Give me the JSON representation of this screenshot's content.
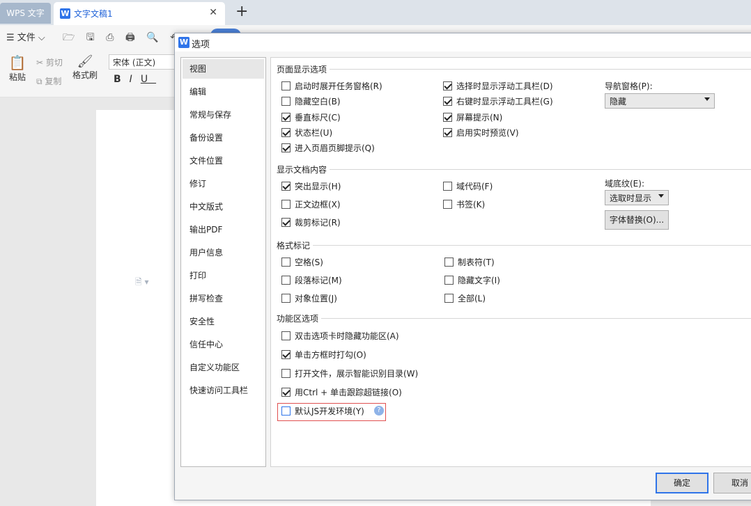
{
  "tabs": {
    "wps": "WPS 文字",
    "doc_icon": "W",
    "doc_title": "文字文稿1",
    "close": "✕",
    "add": "+"
  },
  "toolbar": {
    "file_menu": "☰ 文件 ⌵",
    "paste_label": "粘贴",
    "cut_label": "剪切",
    "copy_label": "复制",
    "format_painter_label": "格式刷",
    "font_name": "宋体 (正文)",
    "bold": "B",
    "italic": "I",
    "underline": "U"
  },
  "dialog": {
    "icon": "W",
    "title": "选项",
    "nav": [
      "视图",
      "编辑",
      "常规与保存",
      "备份设置",
      "文件位置",
      "修订",
      "中文版式",
      "输出PDF",
      "用户信息",
      "打印",
      "拼写检查",
      "安全性",
      "信任中心",
      "自定义功能区",
      "快速访问工具栏"
    ],
    "nav_active_index": 0,
    "page_display": {
      "title": "页面显示选项",
      "items": [
        {
          "label": "启动时展开任务窗格(R)",
          "checked": false
        },
        {
          "label": "隐藏空白(B)",
          "checked": false
        },
        {
          "label": "垂直标尺(C)",
          "checked": true
        },
        {
          "label": "状态栏(U)",
          "checked": true
        },
        {
          "label": "进入页眉页脚提示(Q)",
          "checked": true
        },
        {
          "label": "选择时显示浮动工具栏(D)",
          "checked": true
        },
        {
          "label": "右键时显示浮动工具栏(G)",
          "checked": true
        },
        {
          "label": "屏幕提示(N)",
          "checked": true
        },
        {
          "label": "启用实时预览(V)",
          "checked": true
        }
      ],
      "nav_pane_label": "导航窗格(P):",
      "nav_pane_value": "隐藏"
    },
    "doc_content": {
      "title": "显示文档内容",
      "items": [
        {
          "label": "突出显示(H)",
          "checked": true
        },
        {
          "label": "正文边框(X)",
          "checked": false
        },
        {
          "label": "裁剪标记(R)",
          "checked": true
        },
        {
          "label": "域代码(F)",
          "checked": false
        },
        {
          "label": "书签(K)",
          "checked": false
        }
      ],
      "field_shading_label": "域底纹(E):",
      "field_shading_value": "选取时显示",
      "font_sub_button": "字体替换(O)..."
    },
    "format_marks": {
      "title": "格式标记",
      "items": [
        {
          "label": "空格(S)",
          "checked": false
        },
        {
          "label": "段落标记(M)",
          "checked": false
        },
        {
          "label": "对象位置(J)",
          "checked": false
        },
        {
          "label": "制表符(T)",
          "checked": false
        },
        {
          "label": "隐藏文字(I)",
          "checked": false
        },
        {
          "label": "全部(L)",
          "checked": false
        }
      ]
    },
    "ribbon_options": {
      "title": "功能区选项",
      "items": [
        {
          "label": "双击选项卡时隐藏功能区(A)",
          "checked": false
        },
        {
          "label": "单击方框时打勾(O)",
          "checked": true
        },
        {
          "label": "打开文件，展示智能识别目录(W)",
          "checked": false
        },
        {
          "label": "用Ctrl + 单击跟踪超链接(O)",
          "checked": true
        },
        {
          "label": "默认JS开发环境(Y)",
          "checked": false
        }
      ],
      "help_icon": "?"
    },
    "ok_button": "确定",
    "cancel_button": "取消"
  }
}
